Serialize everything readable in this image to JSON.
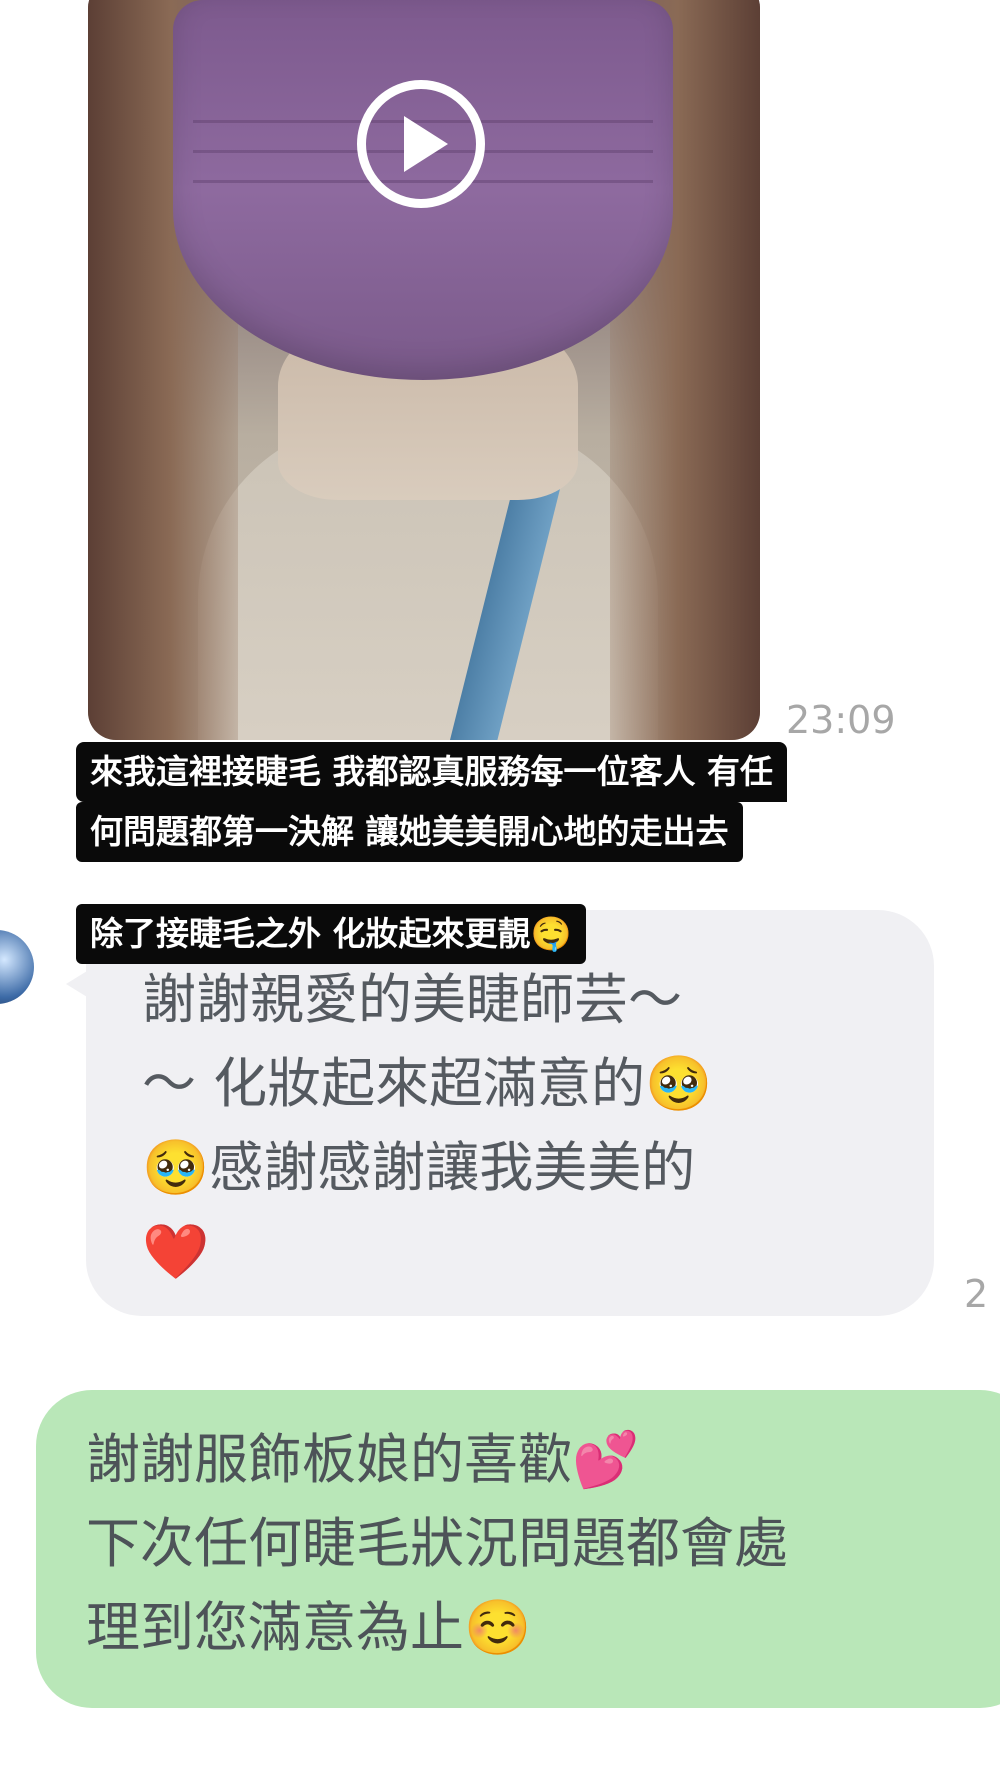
{
  "video_message": {
    "time": "23:09"
  },
  "captions": {
    "line1": "來我這裡接睫毛 我都認真服務每一位客人 有任",
    "line2": "何問題都第一決解  讓她美美開心地的走出去",
    "line3": "除了接睫毛之外 化妝起來更靚🤤"
  },
  "received_message": {
    "line1": "謝謝親愛的美睫師芸～",
    "line2": "～ 化妝起來超滿意的🥹",
    "line3": "🥹感謝感謝讓我美美的",
    "line4": "❤️",
    "time_partial": "2"
  },
  "sent_message": {
    "line1": "謝謝服飾板娘的喜歡💕",
    "line2": "下次任何睫毛狀況問題都會處",
    "line3": "理到您滿意為止☺️"
  },
  "icons": {
    "play": "play-icon",
    "avatar": "avatar"
  },
  "colors": {
    "received_bubble": "#f0f0f3",
    "sent_bubble": "#b9e7b8",
    "caption_bg": "#0a0a0a",
    "timestamp": "#a7a7a7"
  }
}
